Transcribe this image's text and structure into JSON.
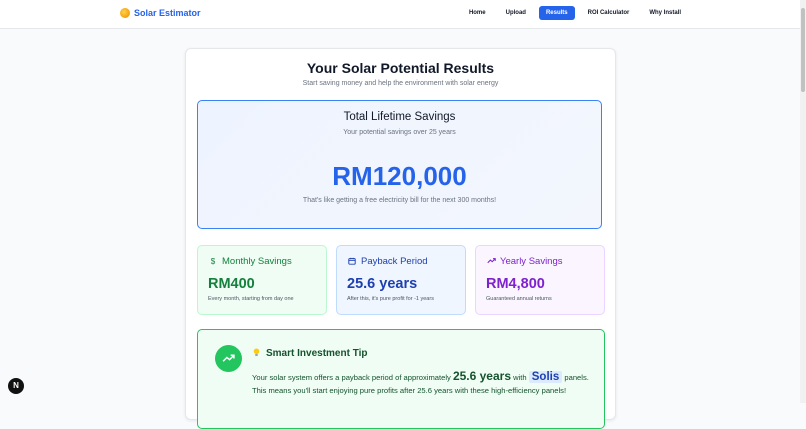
{
  "app": {
    "name": "Solar Estimator",
    "logo_icon": "sun-icon"
  },
  "nav": {
    "items": [
      {
        "label": "Home",
        "active": false
      },
      {
        "label": "Upload",
        "active": false
      },
      {
        "label": "Results",
        "active": true
      },
      {
        "label": "ROI Calculator",
        "active": false
      },
      {
        "label": "Why Install",
        "active": false
      }
    ]
  },
  "colors": {
    "accent": "#2563eb",
    "green": "#22c55e",
    "purple": "#7e22ce"
  },
  "results": {
    "title": "Your Solar Potential Results",
    "subtitle": "Start saving money and help the environment with solar energy",
    "lifetime": {
      "title": "Total Lifetime Savings",
      "subtitle": "Your potential savings over 25 years",
      "amount": "RM120,000",
      "note": "That's like getting a free electricity bill for the next 300 months!"
    },
    "stats": [
      {
        "icon": "dollar-icon",
        "title": "Monthly Savings",
        "value": "RM400",
        "note": "Every month, starting from day one"
      },
      {
        "icon": "calendar-icon",
        "title": "Payback Period",
        "value": "25.6 years",
        "note": "After this, it's pure profit for -1 years"
      },
      {
        "icon": "trend-up-icon",
        "title": "Yearly Savings",
        "value": "RM4,800",
        "note": "Guaranteed annual returns"
      }
    ],
    "tip": {
      "icon": "trending-up-icon",
      "title": "Smart Investment Tip",
      "text_1": "Your solar system offers a payback period of approximately",
      "payback": "25.6 years",
      "text_2": "with",
      "brand": "Solis",
      "text_3": "panels. This means you'll start enjoying pure profits after 25.6 years with these high-efficiency panels!"
    }
  },
  "badge": {
    "label": "N"
  }
}
